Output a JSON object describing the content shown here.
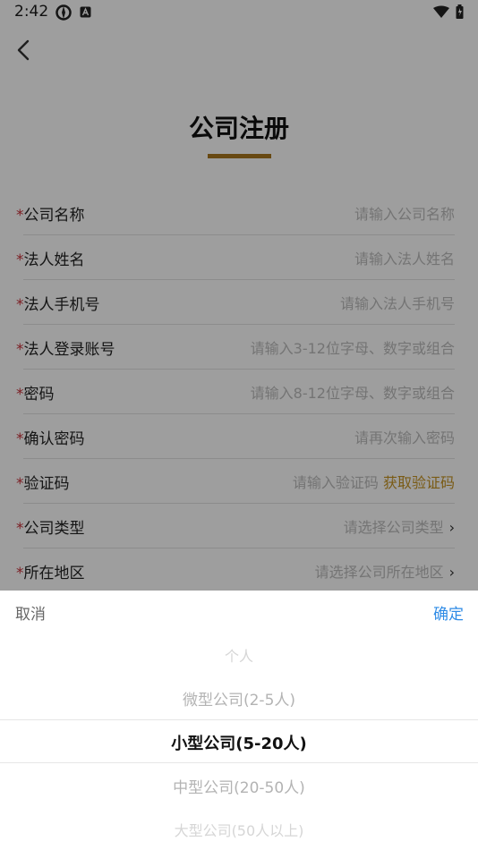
{
  "status_bar": {
    "time": "2:42"
  },
  "page": {
    "title": "公司注册"
  },
  "colors": {
    "accent": "#a8761e",
    "link_accent": "#c59322",
    "required": "#c8323a",
    "confirm_blue": "#2e8be6"
  },
  "form": {
    "required_mark": "*",
    "fields": [
      {
        "label": "公司名称",
        "placeholder": "请输入公司名称"
      },
      {
        "label": "法人姓名",
        "placeholder": "请输入法人姓名"
      },
      {
        "label": "法人手机号",
        "placeholder": "请输入法人手机号"
      },
      {
        "label": "法人登录账号",
        "placeholder": "请输入3-12位字母、数字或组合"
      },
      {
        "label": "密码",
        "placeholder": "请输入8-12位字母、数字或组合"
      },
      {
        "label": "确认密码",
        "placeholder": "请再次输入密码"
      },
      {
        "label": "验证码",
        "placeholder": "请输入验证码",
        "action": "获取验证码"
      },
      {
        "label": "公司类型",
        "placeholder": "请选择公司类型"
      },
      {
        "label": "所在地区",
        "placeholder": "请选择公司所在地区"
      }
    ]
  },
  "picker": {
    "cancel": "取消",
    "confirm": "确定",
    "options": [
      "个人",
      "微型公司(2-5人)",
      "小型公司(5-20人)",
      "中型公司(20-50人)",
      "大型公司(50人以上)"
    ],
    "selected_index": 2
  }
}
